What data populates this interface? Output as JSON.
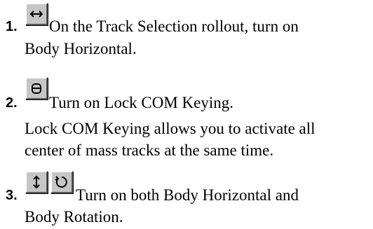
{
  "steps": [
    {
      "number": "1.",
      "icons": [
        "body-horizontal-icon"
      ],
      "line1": "On the Track Selection rollout, turn on",
      "line2": "Body Horizontal."
    },
    {
      "number": "2.",
      "icons": [
        "lock-com-icon"
      ],
      "line1": "Turn on Lock COM Keying.",
      "note_line1": "Lock COM Keying allows you to activate all",
      "note_line2": "center of mass tracks at the same time."
    },
    {
      "number": "3.",
      "icons": [
        "body-vertical-icon",
        "body-rotation-icon"
      ],
      "line1": "Turn on both Body Horizontal and",
      "line2": "Body Rotation."
    }
  ]
}
